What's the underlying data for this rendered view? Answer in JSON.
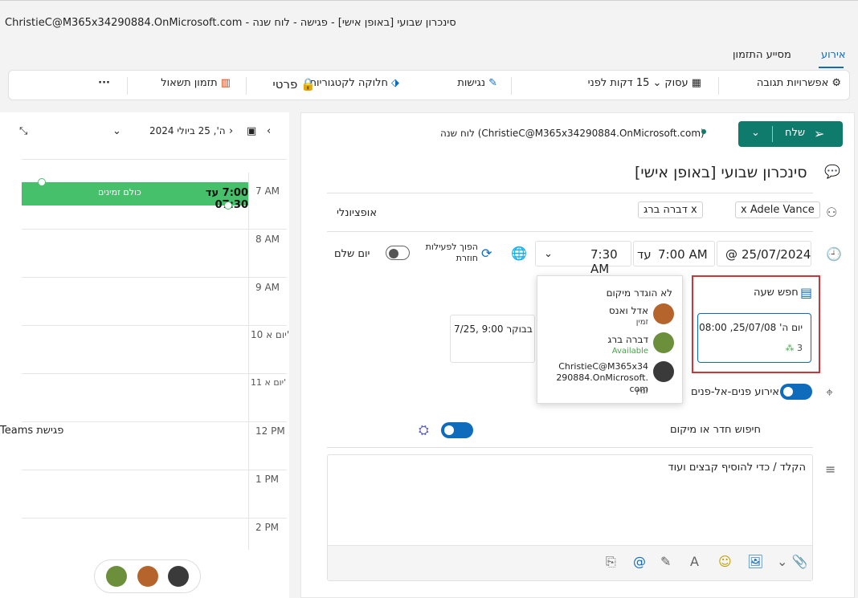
{
  "window": {
    "title": "ChristieC@M365x34290884.OnMicrosoft.com - סינכרון שבועי [באופן אישי] - פגישה - לוח שנה"
  },
  "tabs": [
    {
      "label": "אירוע"
    },
    {
      "label": "מסייע התזמון"
    }
  ],
  "ribbon": {
    "response_options": "אפשרויות תגובה",
    "busy": "עסוק",
    "reminder": "15 דקות לפני",
    "accessibility": "נגישות",
    "sensitivity": "חלוקה לקטגוריות",
    "private": "פרטי",
    "scheduling_poll": "תזמון תשאול",
    "more": "···"
  },
  "calendar": {
    "date_label": "ה', 25 ביולי 2024",
    "hours": [
      "7 AM",
      "8 AM",
      "9 AM",
      "10 יום א'",
      "11 יום א'",
      "12 PM",
      "1 PM",
      "2 PM"
    ],
    "event_time": "7:00 עד 07:30",
    "event_name": "כולם זמינים",
    "teams_label": "Teams פגישת"
  },
  "header": {
    "calendar_label": "לוח שנה (ChristieC@M365x34290884.OnMicrosoft.com)",
    "send": "שלח"
  },
  "event": {
    "title": "סינכרון שבועי [באופן אישי]",
    "attendees": [
      "Adele Vance",
      "דברה ברג"
    ],
    "optional": "אופציונלי",
    "date": "25/07/2024",
    "start": "7:00 AM",
    "until": "עד",
    "end": "7:30 AM",
    "recurring": "הפוך לפעילות חוזרת",
    "all_day": "יום שלם",
    "find_time": "חפש שעה",
    "suggested_slot": "יום ה' 25/07/08, 08:00",
    "slot_count": "3",
    "in_person": "אירוע פנים-אל-פנים",
    "room_search": "חיפוש חדר או מיקום",
    "body_placeholder": "הקלד / כדי להוסיף קבצים ועוד",
    "alt_slot": "7/25, 9:00 בבוקר"
  },
  "popup": {
    "no_location": "לא הוגדר מיקום",
    "people": [
      {
        "name": "אדל ואנס",
        "status": "זמין"
      },
      {
        "name": "דברה ברג",
        "status": "Available"
      },
      {
        "name": "ChristieC@M365x34290884.OnMicrosoft.com",
        "status": "זמין"
      }
    ]
  }
}
